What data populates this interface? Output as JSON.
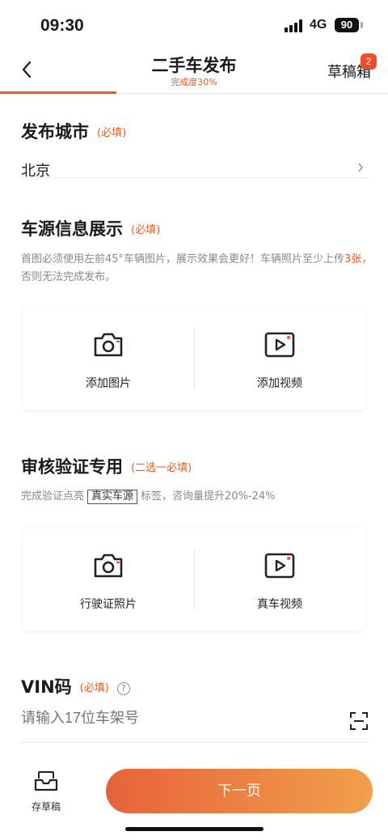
{
  "status_bar": {
    "time": "09:30",
    "network": "4G",
    "battery": "90"
  },
  "nav": {
    "title": "二手车发布",
    "subtitle": "完成度30%",
    "progress": 0.3,
    "drafts_label": "草稿箱",
    "drafts_badge": "2"
  },
  "city_section": {
    "title": "发布城市",
    "required": "(必填)",
    "value": "北京"
  },
  "media_section": {
    "title": "车源信息展示",
    "required": "(必填)",
    "desc_part1": "首图必须使用左前45°车辆图片，展示效果会更好！车辆照片至少上传",
    "desc_highlight": "3张",
    "desc_part2": "，否则无法完成发布。",
    "add_photo": "添加图片",
    "add_video": "添加视频"
  },
  "verify_section": {
    "title": "审核验证专用",
    "required": "(二选一必填)",
    "desc_part1": "完成验证点亮",
    "desc_tag": "真实车源",
    "desc_part2": "标签，咨询量提升20%-24%",
    "license_photo": "行驶证照片",
    "real_video": "真车视频"
  },
  "vin_section": {
    "title": "VIN码",
    "required": "(必填)",
    "help": "?",
    "placeholder": "请输入17位车架号"
  },
  "bottom": {
    "save_draft": "存草稿",
    "next": "下一页"
  },
  "colors": {
    "accent": "#ee5a24",
    "badge": "#ee4d2d",
    "button_start": "#e8623a",
    "button_end": "#f0a04b"
  }
}
